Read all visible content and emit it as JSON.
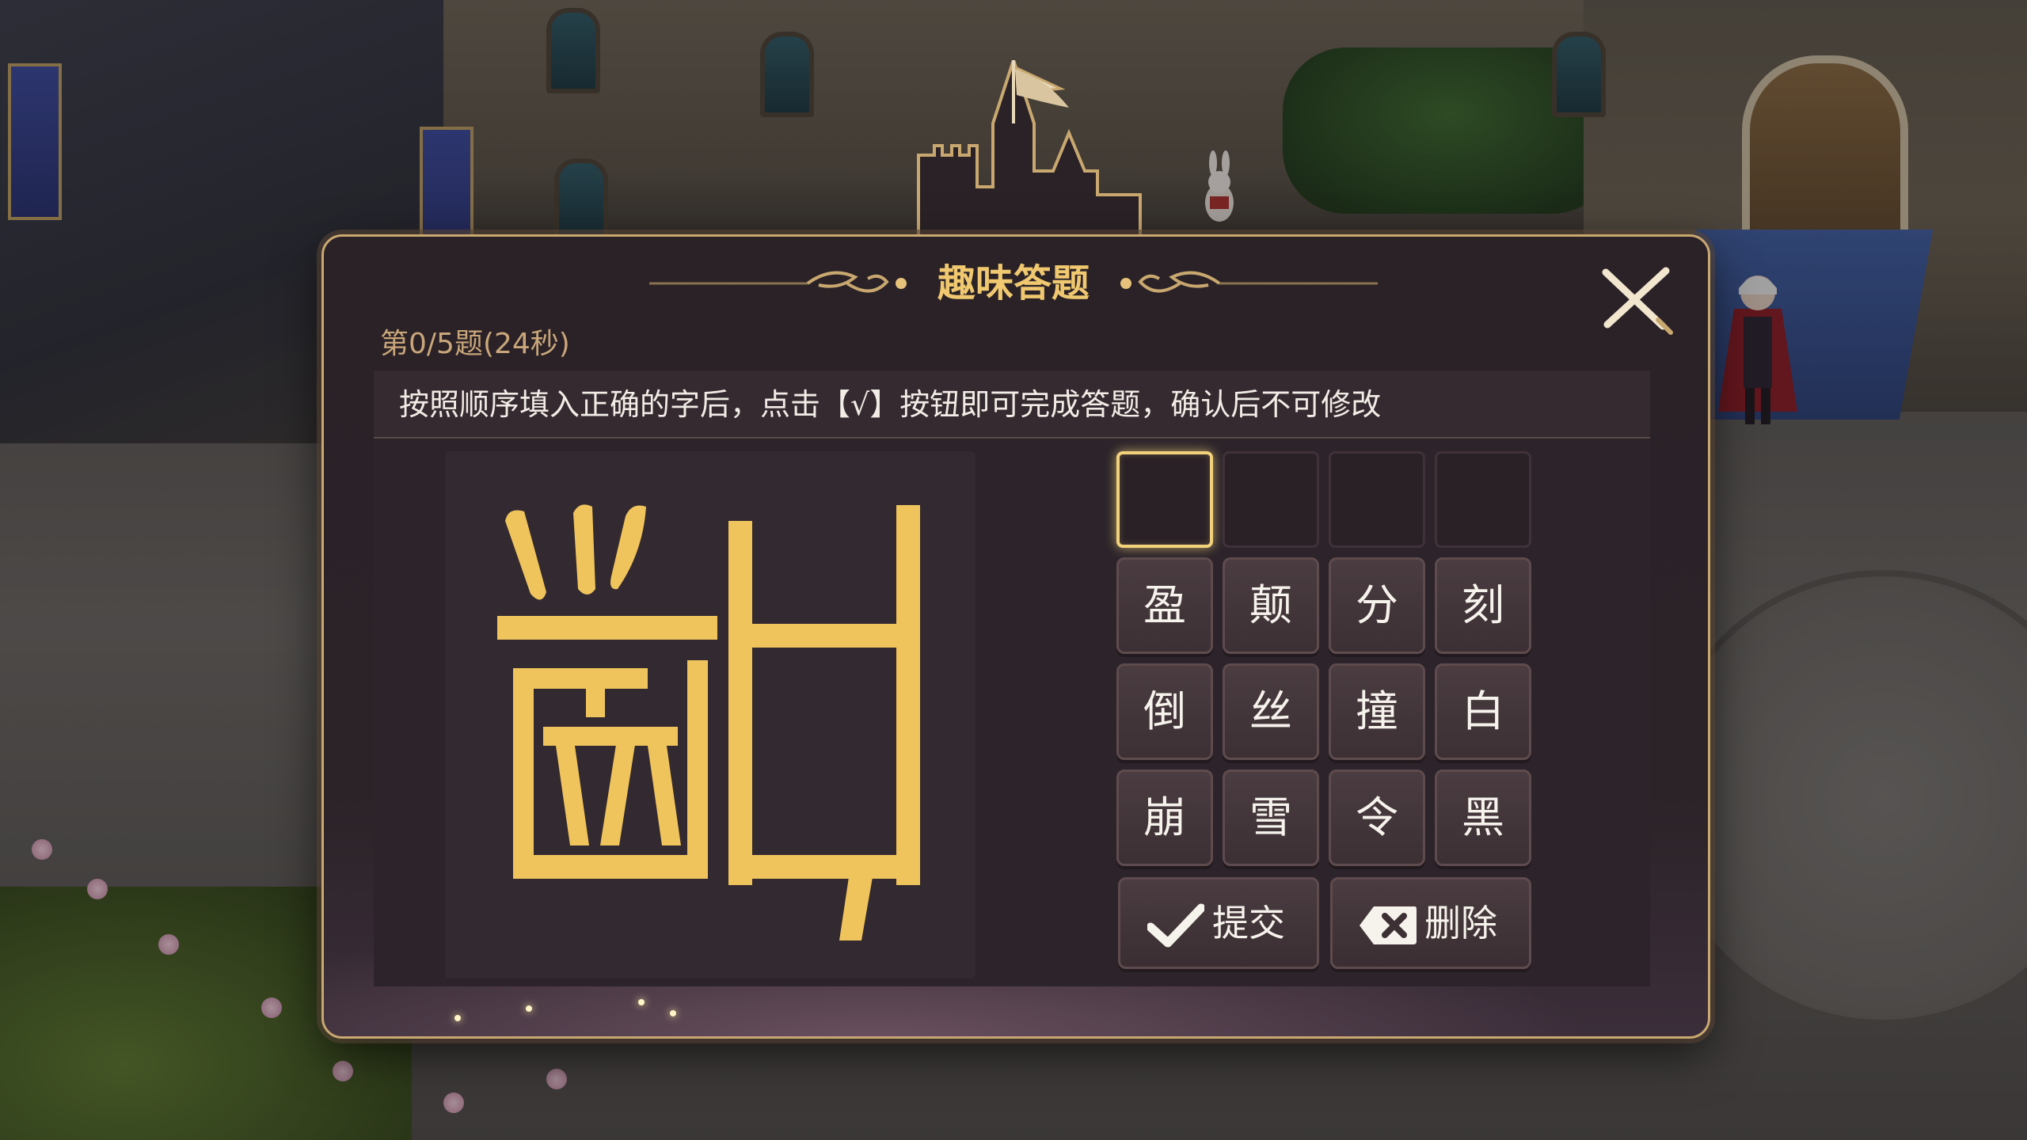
{
  "dialog": {
    "title": "趣味答题",
    "progress": "第0/5题(24秒)",
    "instruction": "按照顺序填入正确的字后，点击【√】按钮即可完成答题，确认后不可修改"
  },
  "answer_slots": [
    "",
    "",
    "",
    ""
  ],
  "active_slot": 0,
  "char_keys": [
    [
      "盈",
      "颠",
      "分",
      "刻"
    ],
    [
      "倒",
      "丝",
      "撞",
      "白"
    ],
    [
      "崩",
      "雪",
      "令",
      "黑"
    ]
  ],
  "actions": {
    "submit_label": "提交",
    "delete_label": "删除"
  },
  "colors": {
    "accent_gold": "#f1d27a",
    "title_gold": "#f0c870",
    "panel_bg": "#2a2227",
    "key_bg": "#4a3c40"
  },
  "icons": {
    "close": "close-icon",
    "check": "check-icon",
    "backspace": "backspace-icon"
  }
}
